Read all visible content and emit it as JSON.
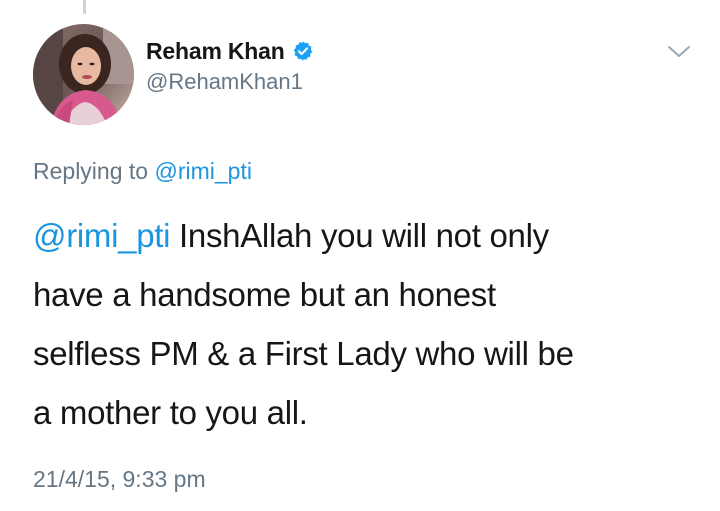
{
  "author": {
    "display_name": "Reham Khan",
    "handle": "@RehamKhan1",
    "verified": true,
    "avatar_icon": "profile-photo",
    "verified_icon": "verified-badge-icon",
    "verified_color": "#1da1f2"
  },
  "reply_context": {
    "prefix": "Replying to",
    "mention": "@rimi_pti"
  },
  "tweet": {
    "mention": "@rimi_pti",
    "line1_rest": " InshAllah you will not only",
    "line2": "have a handsome but an honest",
    "line3": "selfless PM & a First Lady who will be",
    "line4": "a mother to you all."
  },
  "timestamp": "21/4/15, 9:33 pm",
  "colors": {
    "text": "#14171a",
    "secondary": "#657786",
    "link": "#1b95e0"
  },
  "menu_icon": "chevron-down-icon"
}
